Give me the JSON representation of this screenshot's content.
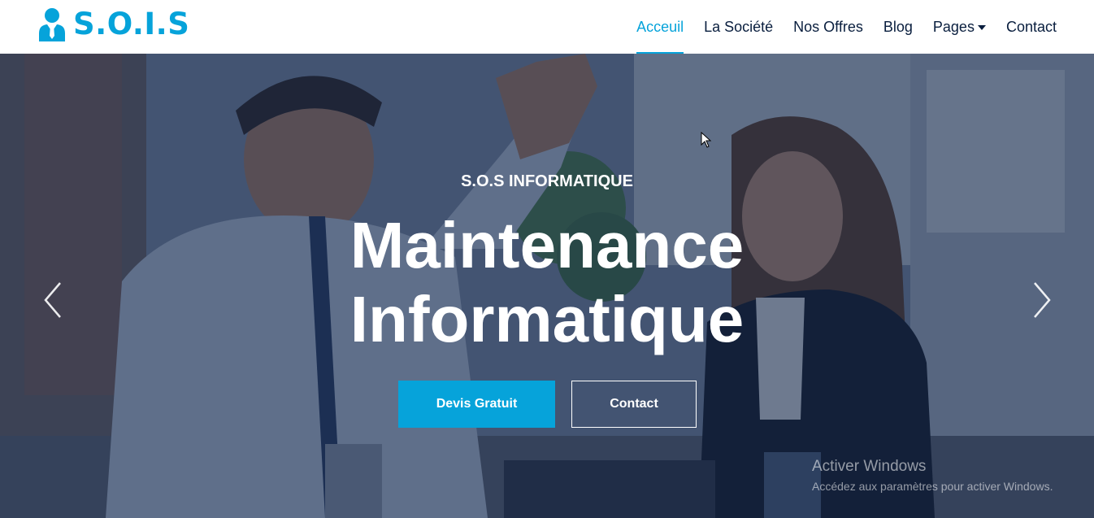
{
  "brand": {
    "name": "S.O.I.S",
    "icon": "user-tie-icon",
    "color": "#06A3DA"
  },
  "nav": {
    "items": [
      {
        "label": "Acceuil",
        "active": true
      },
      {
        "label": "La Société",
        "active": false
      },
      {
        "label": "Nos Offres",
        "active": false
      },
      {
        "label": "Blog",
        "active": false
      },
      {
        "label": "Pages",
        "active": false,
        "dropdown": true
      },
      {
        "label": "Contact",
        "active": false
      }
    ]
  },
  "hero": {
    "eyebrow": "S.O.S INFORMATIQUE",
    "headline_line1": "Maintenance",
    "headline_line2": "Informatique",
    "primary_button": "Devis Gratuit",
    "secondary_button": "Contact",
    "prev_icon": "chevron-left-icon",
    "next_icon": "chevron-right-icon"
  },
  "watermark": {
    "title": "Activer Windows",
    "subtitle": "Accédez aux paramètres pour activer Windows."
  },
  "colors": {
    "accent": "#06A3DA",
    "dark": "#091E3E",
    "overlay": "rgba(9,30,62,0.55)"
  }
}
